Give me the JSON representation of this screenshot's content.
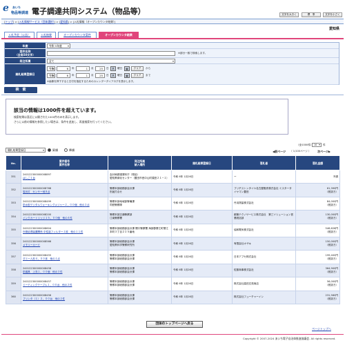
{
  "header": {
    "logo_top": "あいち",
    "logo_bottom": "物品等調達",
    "title": "電子調達共同システム（物品等）",
    "font_large": "文字を大きく",
    "font_standard": "標　準",
    "font_small": "文字を小さく"
  },
  "breadcrumb": {
    "items": [
      "トップ",
      "入札情報サービス（団体選択）",
      "愛知県"
    ],
    "current": "入札情報（オープンカウンタ結果）"
  },
  "prefecture": "愛知県",
  "tabs": [
    {
      "label": "入札予定（公告）"
    },
    {
      "label": "入札結果"
    },
    {
      "label": "オープンカウンタ案件"
    },
    {
      "label": "オープンカウンタ結果"
    }
  ],
  "form": {
    "year_label": "年度",
    "year_value": "令和 5年度",
    "case_label_1": "案件名称",
    "case_label_2": "（全角50文字）",
    "case_value": "",
    "case_note": "※部分一致で検索します。",
    "dept_label": "発注所属",
    "dept_value": "全て",
    "date_label": "開札結果登録日",
    "era1": "令和",
    "y1": "6",
    "y1_unit": "年",
    "m1": "1",
    "m1_unit": "月",
    "d1": "25",
    "d1_unit": "日",
    "dow1": "木",
    "dow_unit1": "曜日",
    "clear1": "クリア",
    "from": "から",
    "era2": "令和",
    "y2": "6",
    "y2_unit": "年",
    "m2": "1",
    "m2_unit": "月",
    "d2": "25",
    "d2_unit": "日",
    "dow2": "木",
    "dow_unit2": "曜日",
    "clear2": "クリア",
    "to": "まで",
    "calendar_note": "※画像を押下すると日付を指定するためのカレンダーダイアログを表示します。",
    "search_button": "検　索"
  },
  "notice": {
    "title": "該当の情報は1000件を超えています。",
    "line1": "検索結果は直近に公開された1000件のみを表示します。",
    "line2": "さらに以前の情報を参照したい場合は、条件を追加し、再度検索を行ってください。"
  },
  "sort": {
    "key": "開札結果登録日",
    "asc": "昇順",
    "desc": "降順"
  },
  "paging": {
    "count": "（全1000件）",
    "per_page": "10",
    "per_page_unit": "件",
    "prev": "◀前ページ",
    "info": "（ 1/100ページ ）",
    "next": "次ページ▶"
  },
  "table": {
    "headers": {
      "no": "No.",
      "case_no": "案件番号",
      "case_name": "案件名称",
      "dept": "発注所属",
      "place": "納入場所",
      "date": "開札結果登録日",
      "winner": "落札者",
      "amount": "落札金額"
    },
    "rows": [
      {
        "no": "351",
        "case_no": "240122300000008897",
        "case_name": "はしご１台",
        "dept": "会計局調達課本庁（物品）",
        "place": "愛知県緑化センター（豊田市西中山町猿田２１−１）",
        "date": "令和 6年 1月26日",
        "winner": "ー",
        "amount": "不調",
        "tax": ""
      },
      {
        "no": "352",
        "case_no": "240122300000008768",
        "case_name": "蛍光灯　センサー他８点",
        "dept": "警察本部総務部会計課",
        "place": "別途打合せ",
        "date": "令和 6年 1月26日",
        "winner": "ブリヂストンタイヤ名古屋販売株式会社 ミスタータイヤマン豊田",
        "amount": "61,390円",
        "tax": "（税抜き）"
      },
      {
        "no": "353",
        "case_no": "240122300000008499",
        "case_name": "防水型デジタルウォーキングメジャー２，００個　他の２点",
        "dept": "警察本部地域部警備課",
        "place": "同鉄警察隊",
        "date": "令和 6年 1月26日",
        "winner": "丹羽測量株式会社",
        "amount": "84,000円",
        "tax": "（税抜き）"
      },
      {
        "no": "354",
        "case_no": "240122300000008200",
        "case_name": "インクカートリッジ１５，００個　他の４件",
        "dept": "警察本部交通警察部",
        "place": "江南警察署",
        "date": "令和 6年 1月26日",
        "winner": "都築テクノサービス株式会社　第三ソリューション営業統括部",
        "amount": "130,000円",
        "tax": "（税抜き）"
      },
      {
        "no": "355",
        "case_no": "240122300000008604",
        "case_name": "外務処理装置関係 中性能フィルター１枚　他の１１件",
        "dept": "警察本部総務部会計課 開口警察署 海部郡蟹江町蟹江本町３丁目２２５番地",
        "place": "",
        "date": "令和 6年 1月26日",
        "winner": "協和電気株式会社",
        "amount": "546,626円",
        "tax": "（税抜き）"
      },
      {
        "no": "356",
        "case_no": "240122300000008566",
        "case_name": "メモリーカード",
        "dept": "警察本部総務部会計課",
        "place": "愛知県科学警察研究所",
        "date": "令和 6年 1月26日",
        "winner": "有限会社オザキ",
        "amount": "150,000円",
        "tax": "（税抜き）"
      },
      {
        "no": "357",
        "case_no": "240122300000008455",
        "case_name": "ダミー人形４，００体　他の１点",
        "dept": "警察本部総務部会計課",
        "place": "警察本部総務部会計課",
        "date": "令和 6年 1月26日",
        "winner": "日本アプセ株式会社",
        "amount": "199,400円",
        "tax": "（税抜き）"
      },
      {
        "no": "358",
        "case_no": "240122300000008458",
        "case_name": "防護具　上衣１，００個　他の３件",
        "dept": "警察本部総務部会計課",
        "place": "警察本部総務部会計課",
        "date": "令和 6年 1月26日",
        "winner": "佐藤商事株式会社",
        "amount": "364,900円",
        "tax": "（税抜き）"
      },
      {
        "no": "359",
        "case_no": "240122300000008457",
        "case_name": "ミーティングテーブル１，００台　他の２件",
        "dept": "警察本部総務部会計課",
        "place": "警察本部総務部会計課",
        "date": "令和 6年 1月26日",
        "winner": "株式会社高田文苑商店",
        "amount": "56,000円",
        "tax": "（税抜き）"
      },
      {
        "no": "360",
        "case_no": "240122300000008456",
        "case_name": "プリンタ（１）２，００台　他の２件",
        "dept": "警察本部総務部会計課",
        "place": "警察本部総務部会計課",
        "date": "令和 6年 1月26日",
        "winner": "株式会社フューチャーイン",
        "amount": "231,580円",
        "tax": "（税抜き）"
      }
    ]
  },
  "footer": {
    "top_button": "団体のトップページへ戻る",
    "page_top": "ページトップへ",
    "copyright": "Copyright © 2007-2024 あいち電子自治体推進協議会. All rights reserved."
  },
  "colors": {
    "navy": "#27477f",
    "pink": "#e0457b",
    "link": "#1a3fb0"
  }
}
